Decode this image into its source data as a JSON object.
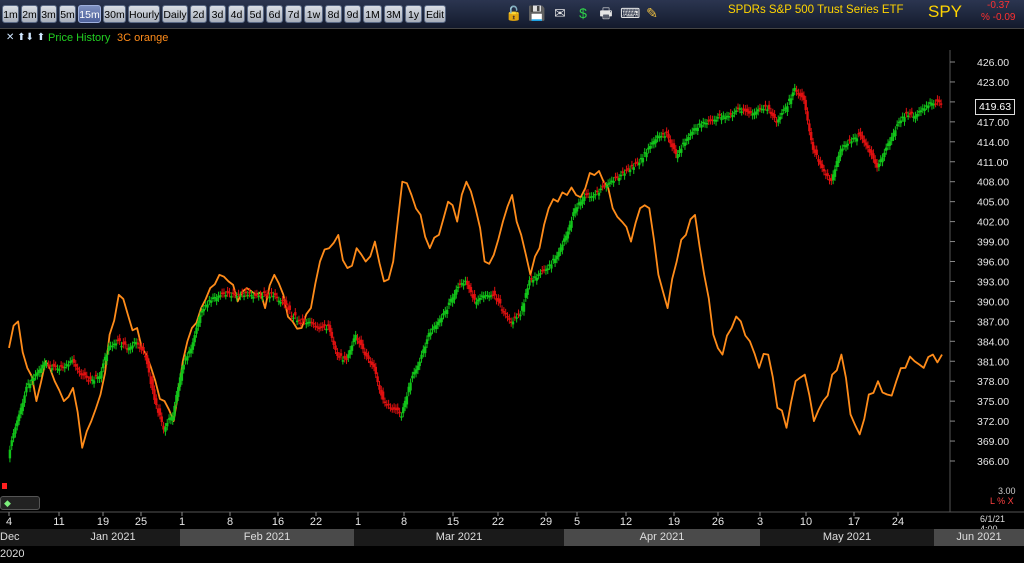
{
  "toolbar": {
    "timeframes": [
      "1m",
      "2m",
      "3m",
      "5m",
      "15m",
      "30m",
      "Hourly",
      "Daily",
      "2d",
      "3d",
      "4d",
      "5d",
      "6d",
      "7d",
      "1w",
      "8d",
      "9d",
      "1M",
      "3M",
      "1y",
      "Edit"
    ],
    "active": "15m",
    "icons": [
      "lock-icon",
      "save-icon",
      "mail-icon",
      "dollar-icon",
      "print-icon",
      "keyboard-icon",
      "pencil-icon"
    ]
  },
  "header": {
    "instrument": "SPDRs S&P 500 Trust Series ETF",
    "ticker": "SPY",
    "change": "-0.37",
    "change_pct": "% -0.09"
  },
  "legend": {
    "arrows": "✕ ⬆⬇ ⬆",
    "price_label": "Price History",
    "indicator_label": "3C orange"
  },
  "last_price": "419.63",
  "indicator_value": "3.00",
  "indicator_units": "L % X",
  "last_date": "6/1/21 4:00",
  "colors": {
    "background": "#000000",
    "indicator": "#ff8c1a",
    "up": "#12c41a",
    "down": "#e01010",
    "title": "#ffd400"
  },
  "chart_data": {
    "type": "line",
    "title": "SPDRs S&P 500 Trust Series ETF",
    "ylim": [
      363,
      428
    ],
    "y_ticks": [
      366,
      369,
      372,
      375,
      378,
      381,
      384,
      387,
      390,
      393,
      396,
      399,
      402,
      405,
      408,
      411,
      414,
      417,
      420,
      423,
      426
    ],
    "x_day_labels": [
      "4",
      "11",
      "19",
      "25",
      "1",
      "8",
      "16",
      "22",
      "1",
      "8",
      "15",
      "22",
      "29",
      "5",
      "12",
      "19",
      "26",
      "3",
      "10",
      "17",
      "24"
    ],
    "x_month_labels": [
      "Dec 2020",
      "Jan 2021",
      "Feb 2021",
      "Mar 2021",
      "Apr 2021",
      "May 2021",
      "Jun 2021"
    ],
    "series": [
      {
        "name": "Price History",
        "x": [
          "Jan 4",
          "Jan 5",
          "Jan 6",
          "Jan 7",
          "Jan 8",
          "Jan 11",
          "Jan 12",
          "Jan 13",
          "Jan 14",
          "Jan 15",
          "Jan 19",
          "Jan 20",
          "Jan 21",
          "Jan 22",
          "Jan 25",
          "Jan 26",
          "Jan 27",
          "Jan 28",
          "Jan 29",
          "Feb 1",
          "Feb 2",
          "Feb 3",
          "Feb 4",
          "Feb 5",
          "Feb 8",
          "Feb 9",
          "Feb 10",
          "Feb 11",
          "Feb 12",
          "Feb 16",
          "Feb 17",
          "Feb 18",
          "Feb 19",
          "Feb 22",
          "Feb 23",
          "Feb 24",
          "Feb 25",
          "Feb 26",
          "Mar 1",
          "Mar 2",
          "Mar 3",
          "Mar 4",
          "Mar 5",
          "Mar 8",
          "Mar 9",
          "Mar 10",
          "Mar 11",
          "Mar 12",
          "Mar 15",
          "Mar 16",
          "Mar 17",
          "Mar 18",
          "Mar 19",
          "Mar 22",
          "Mar 23",
          "Mar 24",
          "Mar 25",
          "Mar 26",
          "Mar 29",
          "Mar 30",
          "Mar 31",
          "Apr 1",
          "Apr 5",
          "Apr 6",
          "Apr 7",
          "Apr 8",
          "Apr 9",
          "Apr 12",
          "Apr 13",
          "Apr 14",
          "Apr 15",
          "Apr 16",
          "Apr 19",
          "Apr 20",
          "Apr 21",
          "Apr 22",
          "Apr 23",
          "Apr 26",
          "Apr 27",
          "Apr 28",
          "Apr 29",
          "Apr 30",
          "May 3",
          "May 4",
          "May 5",
          "May 6",
          "May 7",
          "May 10",
          "May 11",
          "May 12",
          "May 13",
          "May 14",
          "May 17",
          "May 18",
          "May 19",
          "May 20",
          "May 21",
          "May 24",
          "May 25",
          "May 26",
          "May 27",
          "May 28",
          "Jun 1"
        ],
        "values": [
          367,
          372,
          377,
          379,
          381,
          380,
          380,
          381,
          379,
          378,
          379,
          383,
          384,
          383,
          384,
          382,
          375,
          371,
          373,
          380,
          383,
          388,
          390,
          391,
          391,
          391,
          391,
          391,
          391,
          391,
          390,
          388,
          387,
          387,
          386,
          386,
          382,
          381,
          385,
          382,
          380,
          375,
          374,
          373,
          378,
          381,
          385,
          387,
          389,
          392,
          393,
          390,
          391,
          391,
          389,
          387,
          388,
          393,
          394,
          395,
          397,
          400,
          404,
          406,
          406,
          407,
          408,
          409,
          410,
          411,
          413,
          415,
          415,
          412,
          414,
          416,
          417,
          417,
          418,
          418,
          419,
          418,
          419,
          419,
          417,
          419,
          422,
          420,
          413,
          410,
          408,
          413,
          414,
          415,
          413,
          410,
          413,
          416,
          418,
          418,
          419,
          420,
          419.63
        ]
      },
      {
        "name": "3C orange",
        "x": [
          "Jan 4",
          "Jan 5",
          "Jan 6",
          "Jan 7",
          "Jan 8",
          "Jan 11",
          "Jan 12",
          "Jan 13",
          "Jan 14",
          "Jan 15",
          "Jan 19",
          "Jan 20",
          "Jan 21",
          "Jan 22",
          "Jan 25",
          "Jan 26",
          "Jan 27",
          "Jan 28",
          "Jan 29",
          "Feb 1",
          "Feb 2",
          "Feb 3",
          "Feb 4",
          "Feb 5",
          "Feb 8",
          "Feb 9",
          "Feb 10",
          "Feb 11",
          "Feb 12",
          "Feb 16",
          "Feb 17",
          "Feb 18",
          "Feb 19",
          "Feb 22",
          "Feb 23",
          "Feb 24",
          "Feb 25",
          "Feb 26",
          "Mar 1",
          "Mar 2",
          "Mar 3",
          "Mar 4",
          "Mar 5",
          "Mar 8",
          "Mar 9",
          "Mar 10",
          "Mar 11",
          "Mar 12",
          "Mar 15",
          "Mar 16",
          "Mar 17",
          "Mar 18",
          "Mar 19",
          "Mar 22",
          "Mar 23",
          "Mar 24",
          "Mar 25",
          "Mar 26",
          "Mar 29",
          "Mar 30",
          "Mar 31",
          "Apr 1",
          "Apr 5",
          "Apr 6",
          "Apr 7",
          "Apr 8",
          "Apr 9",
          "Apr 12",
          "Apr 13",
          "Apr 14",
          "Apr 15",
          "Apr 16",
          "Apr 19",
          "Apr 20",
          "Apr 21",
          "Apr 22",
          "Apr 23",
          "Apr 26",
          "Apr 27",
          "Apr 28",
          "Apr 29",
          "Apr 30",
          "May 3",
          "May 4",
          "May 5",
          "May 6",
          "May 7",
          "May 10",
          "May 11",
          "May 12",
          "May 13",
          "May 14",
          "May 17",
          "May 18",
          "May 19",
          "May 20",
          "May 21",
          "May 24",
          "May 25",
          "May 26",
          "May 27",
          "May 28",
          "Jun 1"
        ],
        "values": [
          383,
          387,
          380,
          375,
          381,
          378,
          375,
          377,
          368,
          372,
          376,
          385,
          391,
          388,
          386,
          382,
          378,
          375,
          372,
          381,
          386,
          389,
          392,
          394,
          393,
          390,
          392,
          391,
          389,
          394,
          391,
          387,
          386,
          389,
          396,
          398,
          400,
          395,
          398,
          396,
          399,
          393,
          396,
          408,
          406,
          403,
          398,
          400,
          405,
          402,
          408,
          404,
          396,
          397,
          402,
          406,
          400,
          394,
          398,
          404,
          405,
          406,
          406,
          407,
          409,
          408,
          404,
          402,
          399,
          404,
          404,
          394,
          389,
          396,
          400,
          403,
          394,
          385,
          382,
          386,
          387,
          384,
          380,
          382,
          374,
          371,
          378,
          379,
          372,
          375,
          379,
          382,
          373,
          370,
          376,
          378,
          376,
          378,
          380,
          381,
          380,
          382,
          382
        ]
      }
    ]
  }
}
